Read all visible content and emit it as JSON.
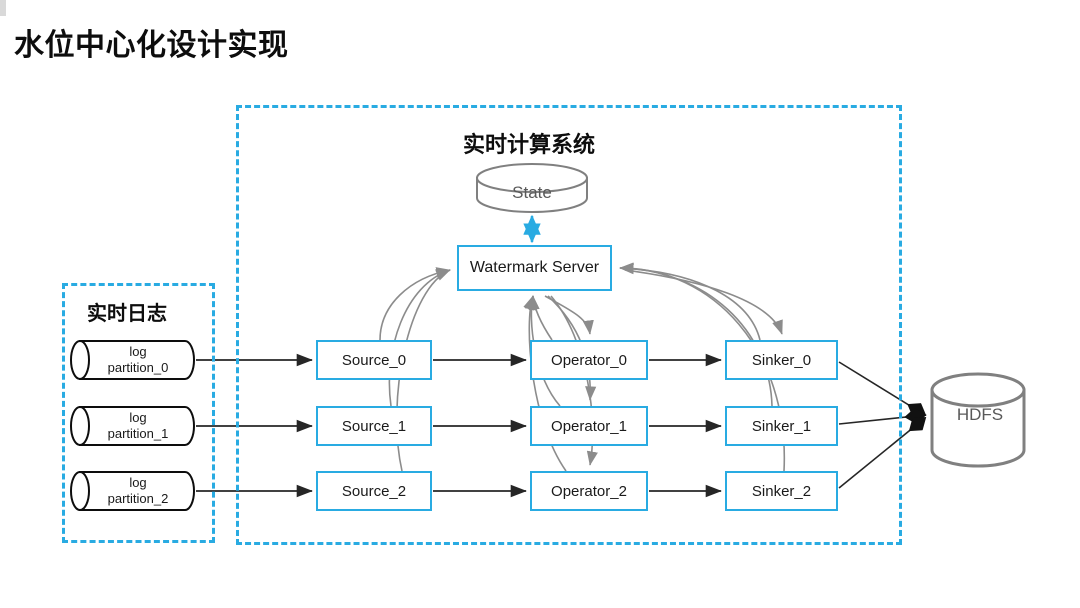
{
  "slide": {
    "title": "水位中心化设计实现",
    "background": "#ffffff"
  },
  "colors": {
    "accent_blue": "#29abe2",
    "node_border": "#29abe2",
    "gray_stroke": "#808080",
    "arrow_black": "#262626",
    "arrow_gray": "#8c8c8c",
    "text_dark": "#1a1a1a",
    "text_gray": "#595959"
  },
  "log_group": {
    "title": "实时日志",
    "border_style": "dashed",
    "items": [
      {
        "label": "log\npartition_0",
        "shape": "cylinder-horizontal"
      },
      {
        "label": "log\npartition_1",
        "shape": "cylinder-horizontal"
      },
      {
        "label": "log\npartition_2",
        "shape": "cylinder-horizontal"
      }
    ]
  },
  "system_group": {
    "title": "实时计算系统",
    "border_style": "dashed",
    "state": {
      "label": "State",
      "shape": "cylinder-vertical"
    },
    "watermark_server": {
      "label": "Watermark Server"
    },
    "sources": [
      {
        "label": "Source_0"
      },
      {
        "label": "Source_1"
      },
      {
        "label": "Source_2"
      }
    ],
    "operators": [
      {
        "label": "Operator_0"
      },
      {
        "label": "Operator_1"
      },
      {
        "label": "Operator_2"
      }
    ],
    "sinkers": [
      {
        "label": "Sinker_0"
      },
      {
        "label": "Sinker_1"
      },
      {
        "label": "Sinker_2"
      }
    ]
  },
  "storage": {
    "label": "HDFS",
    "shape": "cylinder-vertical"
  },
  "connections": {
    "state_watermark": "bidirectional",
    "log_to_source": "right",
    "source_to_operator": "right",
    "operator_to_sinker": "right",
    "sinker_to_hdfs": "converging",
    "source_to_watermark": "curved-up",
    "operator_to_watermark": "curved-up",
    "sinker_to_watermark": "curved-up",
    "watermark_to_operator": "curved-down",
    "watermark_to_sinker": "curved-down"
  }
}
